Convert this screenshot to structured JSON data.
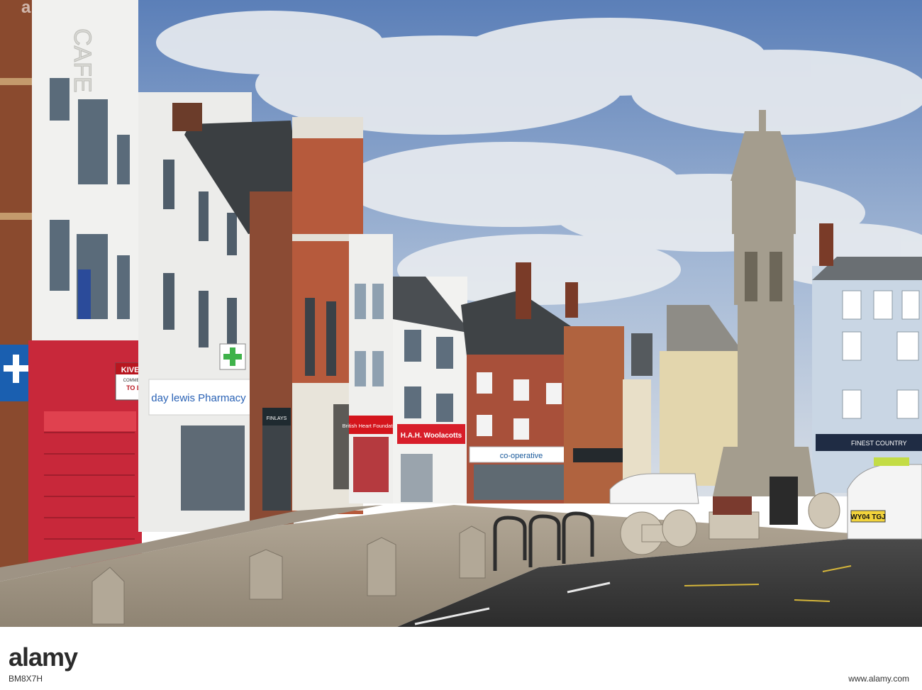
{
  "scene": {
    "signs": {
      "cafe": "CAFE",
      "kivells": "KIVELLS",
      "kivells_sub": "COMMERCIAL",
      "to_let": "TO LET",
      "pharmacy": "day lewis Pharmacy",
      "british_heart": "British Heart Foundation",
      "woolacotts": "H.A.H. Woolacotts",
      "coop": "co-operative",
      "finest": "FINEST COUNTRY",
      "finlays": "FINLAYS",
      "taxi_plate": "WY04 TGJ"
    }
  },
  "watermark": {
    "brand": "a",
    "image_id": "BM8X7H",
    "site": "www.alamy.com",
    "logo": "alamy"
  }
}
